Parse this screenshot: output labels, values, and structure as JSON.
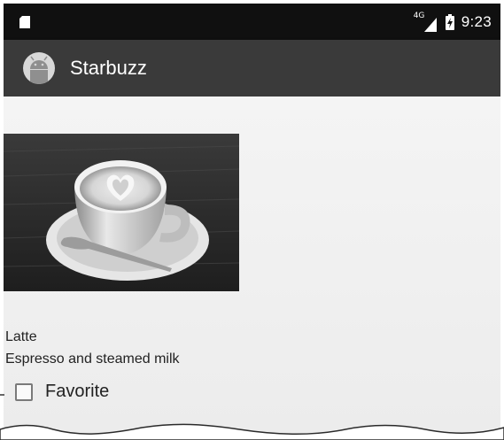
{
  "status_bar": {
    "sd_icon": "sd-card-icon",
    "network_label": "4G",
    "signal_icon": "signal-icon",
    "battery_icon": "battery-charging-icon",
    "time": "9:23"
  },
  "app_bar": {
    "icon": "android-app-icon",
    "title": "Starbuzz"
  },
  "drink": {
    "photo_icon": "latte-photo",
    "name": "Latte",
    "description": "Espresso and steamed milk",
    "favorite": {
      "label": "Favorite",
      "checked": false
    }
  },
  "colors": {
    "status_bar": "#101010",
    "app_bar": "#3a3a3a",
    "background": "#f0f0f0",
    "text": "#222222"
  }
}
